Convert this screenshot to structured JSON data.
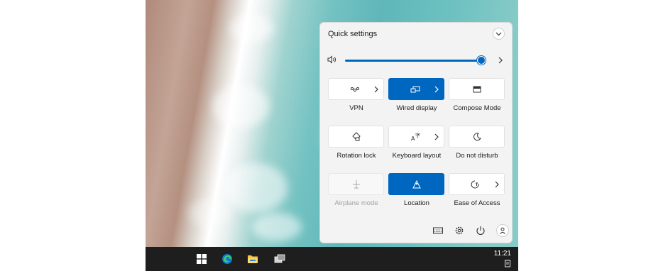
{
  "quick_settings": {
    "title": "Quick settings",
    "volume_level_percent": 96,
    "tiles": [
      {
        "label": "VPN",
        "icon": "vpn-icon",
        "active": false,
        "disabled": false,
        "has_chevron": true
      },
      {
        "label": "Wired display",
        "icon": "wired-display-icon",
        "active": true,
        "disabled": false,
        "has_chevron": true
      },
      {
        "label": "Compose Mode",
        "icon": "compose-mode-icon",
        "active": false,
        "disabled": false,
        "has_chevron": false
      },
      {
        "label": "Rotation lock",
        "icon": "rotation-lock-icon",
        "active": false,
        "disabled": false,
        "has_chevron": false
      },
      {
        "label": "Keyboard layout",
        "icon": "keyboard-layout-icon",
        "active": false,
        "disabled": false,
        "has_chevron": true
      },
      {
        "label": "Do not disturb",
        "icon": "moon-icon",
        "active": false,
        "disabled": false,
        "has_chevron": false
      },
      {
        "label": "Airplane mode",
        "icon": "airplane-icon",
        "active": false,
        "disabled": true,
        "has_chevron": false
      },
      {
        "label": "Location",
        "icon": "location-icon",
        "active": true,
        "disabled": false,
        "has_chevron": false
      },
      {
        "label": "Ease of Access",
        "icon": "ease-of-access-icon",
        "active": false,
        "disabled": false,
        "has_chevron": true
      }
    ],
    "footer_icons": [
      "keyboard-icon",
      "gear-icon",
      "power-icon",
      "user-icon"
    ]
  },
  "taskbar": {
    "icons": [
      "windows-start-icon",
      "edge-browser-icon",
      "file-explorer-icon",
      "task-view-icon"
    ],
    "time": "11:21"
  },
  "colors": {
    "accent": "#0067c0",
    "panel_bg": "#f3f3f3",
    "taskbar_bg": "#1e1e1e"
  }
}
